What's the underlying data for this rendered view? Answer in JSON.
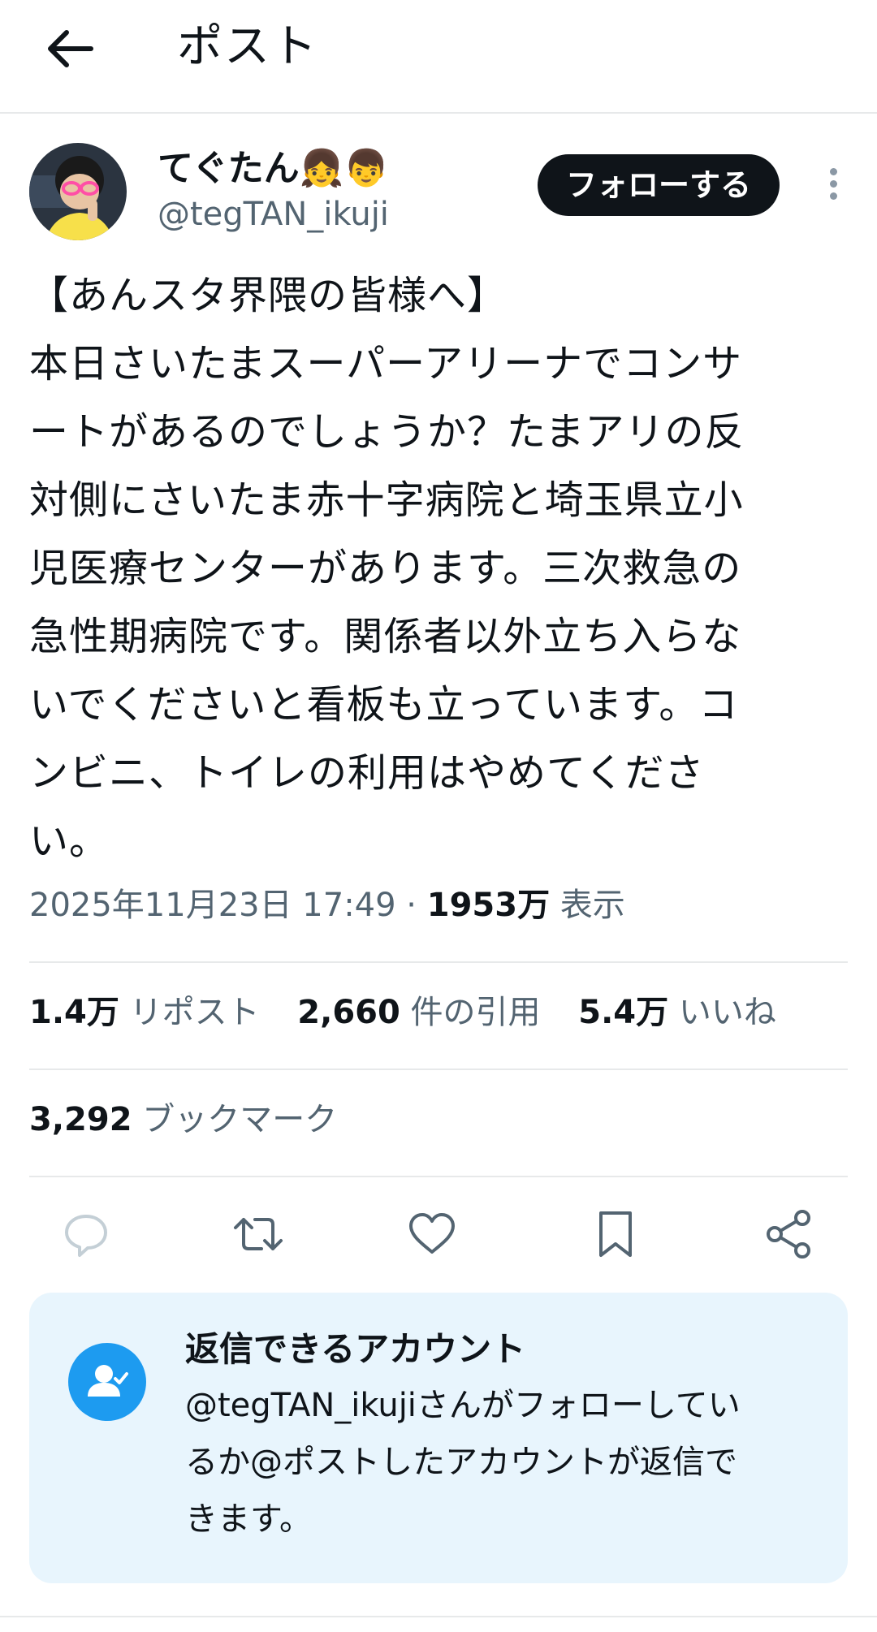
{
  "header": {
    "title": "ポスト",
    "back_icon": "arrow-left-icon"
  },
  "author": {
    "display_name": "てぐたん👧👦",
    "handle": "@tegTAN_ikuji",
    "follow_label": "フォローする",
    "more_icon": "more-vertical-icon"
  },
  "post": {
    "text": "【あんスタ界隈の皆様へ】\n本日さいたまスーパーアリーナでコンサ\nートがあるのでしょうか？たまアリの反\n対側にさいたま赤十字病院と埼玉県立小\n児医療センターがあります。三次救急の\n急性期病院です。関係者以外立ち入らな\nいでくださいと看板も立っています。コ\nンビニ、トイレの利用はやめてくださ\nい。",
    "timestamp": "2025年11月23日 17:49",
    "separator": " · ",
    "views_count": "1953万",
    "views_label": " 表示"
  },
  "stats": {
    "reposts_count": "1.4万",
    "reposts_label": " リポスト",
    "quotes_count": "2,660",
    "quotes_label": " 件の引用",
    "likes_count": "5.4万",
    "likes_label": " いいね",
    "bookmarks_count": "3,292",
    "bookmarks_label": " ブックマーク"
  },
  "actions": {
    "reply_icon": "reply-bubble-icon",
    "repost_icon": "repost-icon",
    "like_icon": "heart-icon",
    "bookmark_icon": "bookmark-icon",
    "share_icon": "share-icon"
  },
  "reply_restriction": {
    "title": "返信できるアカウント",
    "description": "@tegTAN_ikujiさんがフォローしてい\nるか@ポストしたアカウントが返信で\nきます。",
    "icon": "user-check-icon"
  },
  "colors": {
    "text": "#0f1419",
    "secondary": "#536471",
    "accent": "#1d9bf0",
    "panel": "#e8f5fd"
  }
}
